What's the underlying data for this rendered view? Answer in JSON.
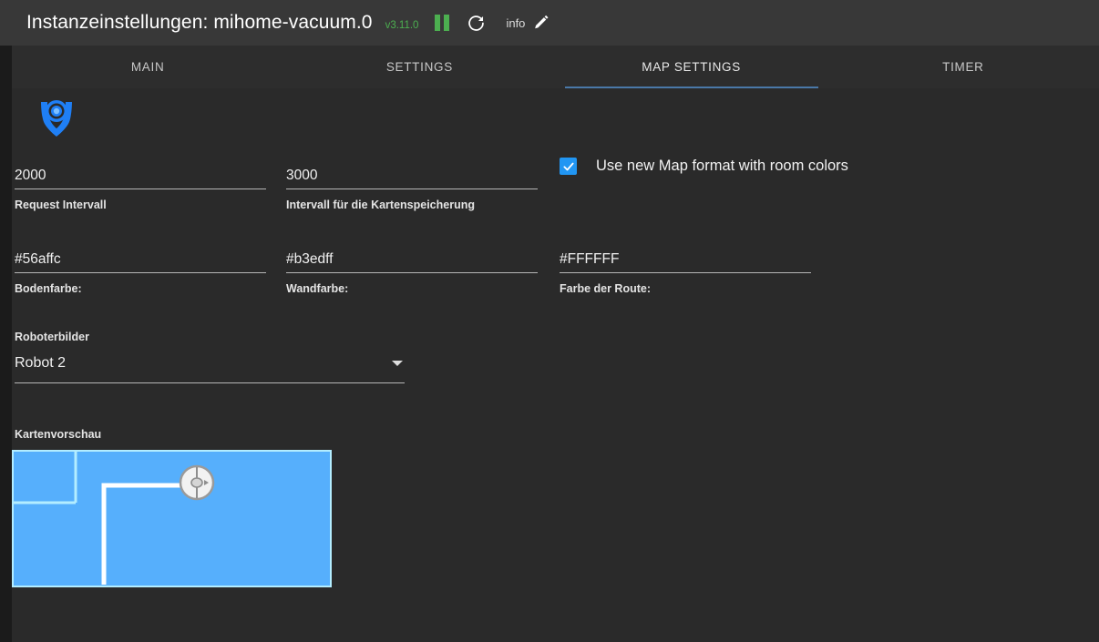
{
  "header": {
    "title": "Instanzeinstellungen: mihome-vacuum.0",
    "version": "v3.11.0",
    "pause_icon": "pause-icon",
    "refresh_icon": "refresh-icon",
    "info_label": "info",
    "edit_icon": "pencil-icon",
    "version_color": "#4caf50",
    "background": "#383838"
  },
  "tabs": [
    {
      "label": "MAIN",
      "active": false
    },
    {
      "label": "SETTINGS",
      "active": false
    },
    {
      "label": "MAP SETTINGS",
      "active": true
    },
    {
      "label": "TIMER",
      "active": false
    }
  ],
  "tab_accent": "#4a78a8",
  "logo": {
    "icon": "vacuum-map-logo-icon",
    "color": "#1f7ff5"
  },
  "fields": {
    "request_interval": {
      "value": "2000",
      "label": "Request Intervall"
    },
    "map_save_interval": {
      "value": "3000",
      "label": "Intervall für die Kartenspeicherung"
    },
    "floor_color": {
      "value": "#56affc",
      "label": "Bodenfarbe:"
    },
    "wall_color": {
      "value": "#b3edff",
      "label": "Wandfarbe:"
    },
    "route_color": {
      "value": "#FFFFFF",
      "label": "Farbe der Route:"
    }
  },
  "checkbox": {
    "label": "Use new Map format with room colors",
    "checked": true,
    "color": "#2196f3"
  },
  "select": {
    "label": "Roboterbilder",
    "value": "Robot 2",
    "caret_icon": "chevron-down-icon"
  },
  "preview": {
    "label": "Kartenvorschau",
    "floor": "#56affc",
    "wall": "#b3edff",
    "route": "#FFFFFF",
    "robot_icon": "robot-marker-icon"
  },
  "colors": {
    "content_background": "#2a2a2a",
    "tabbar_background": "#2d2d2d",
    "page_background": "#1b1b1b",
    "underline": "#b7b7b7"
  }
}
